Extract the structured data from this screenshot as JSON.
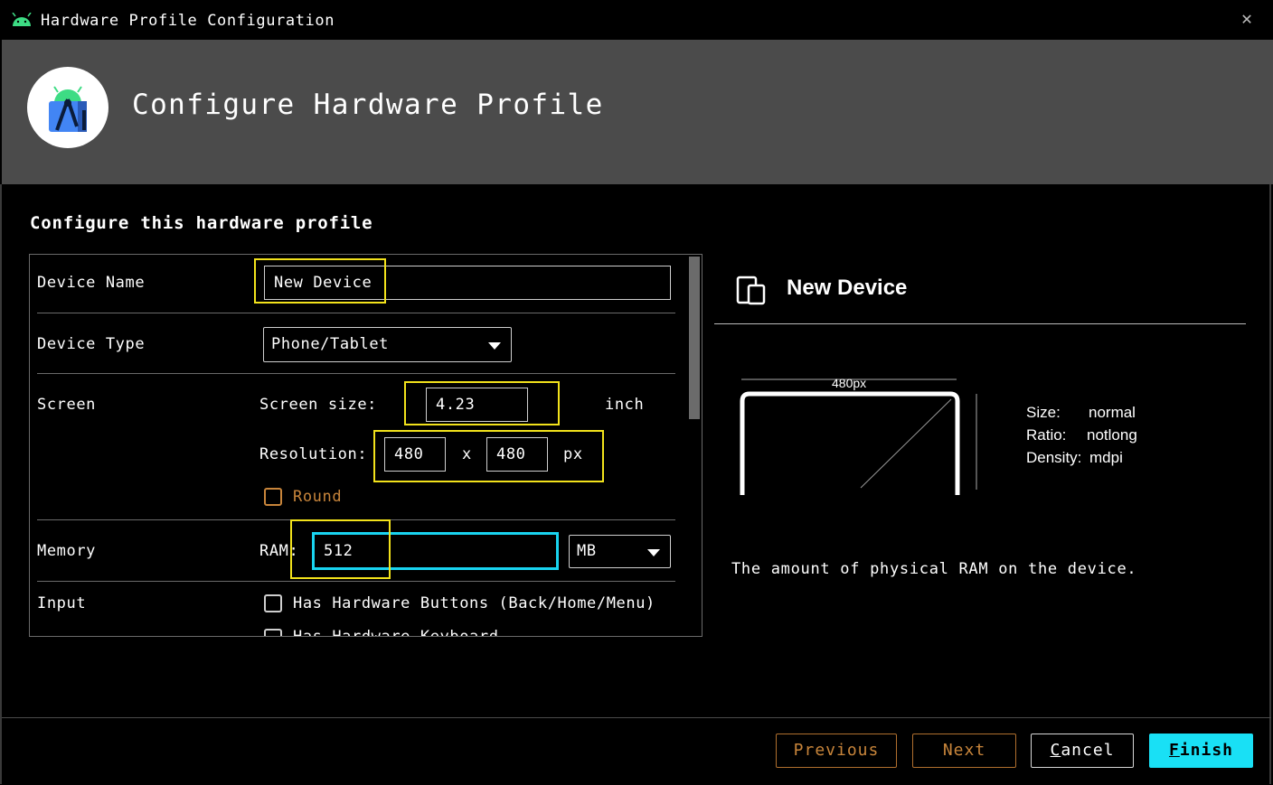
{
  "window": {
    "title": "Hardware Profile Configuration"
  },
  "header": {
    "title": "Configure Hardware Profile"
  },
  "section_title": "Configure this hardware profile",
  "form": {
    "device_name": {
      "label": "Device Name",
      "value": "New Device"
    },
    "device_type": {
      "label": "Device Type",
      "value": "Phone/Tablet"
    },
    "screen": {
      "label": "Screen",
      "size_label": "Screen size:",
      "size_value": "4.23",
      "size_unit": "inch",
      "resolution_label": "Resolution:",
      "res_width": "480",
      "res_x": "x",
      "res_height": "480",
      "res_unit": "px",
      "round_label": "Round"
    },
    "memory": {
      "label": "Memory",
      "ram_label": "RAM:",
      "ram_value": "512",
      "ram_unit": "MB"
    },
    "input": {
      "label": "Input",
      "option1": "Has Hardware Buttons (Back/Home/Menu)",
      "option2": "Has Hardware Keyboard"
    }
  },
  "preview": {
    "device_name": "New Device",
    "width_label": "480px",
    "size_key": "Size:",
    "size_val": "normal",
    "ratio_key": "Ratio:",
    "ratio_val": "notlong",
    "density_key": "Density:",
    "density_val": "mdpi",
    "help": "The amount of physical RAM on the device."
  },
  "buttons": {
    "previous": "Previous",
    "next": "Next",
    "cancel": "Cancel",
    "finish": "Finish"
  },
  "colors": {
    "highlight_yellow": "#f2e21b",
    "highlight_cyan": "#19d4f0",
    "primary": "#19e0f5",
    "disabled": "#c8853b",
    "header_bg": "#4b4b4b"
  }
}
